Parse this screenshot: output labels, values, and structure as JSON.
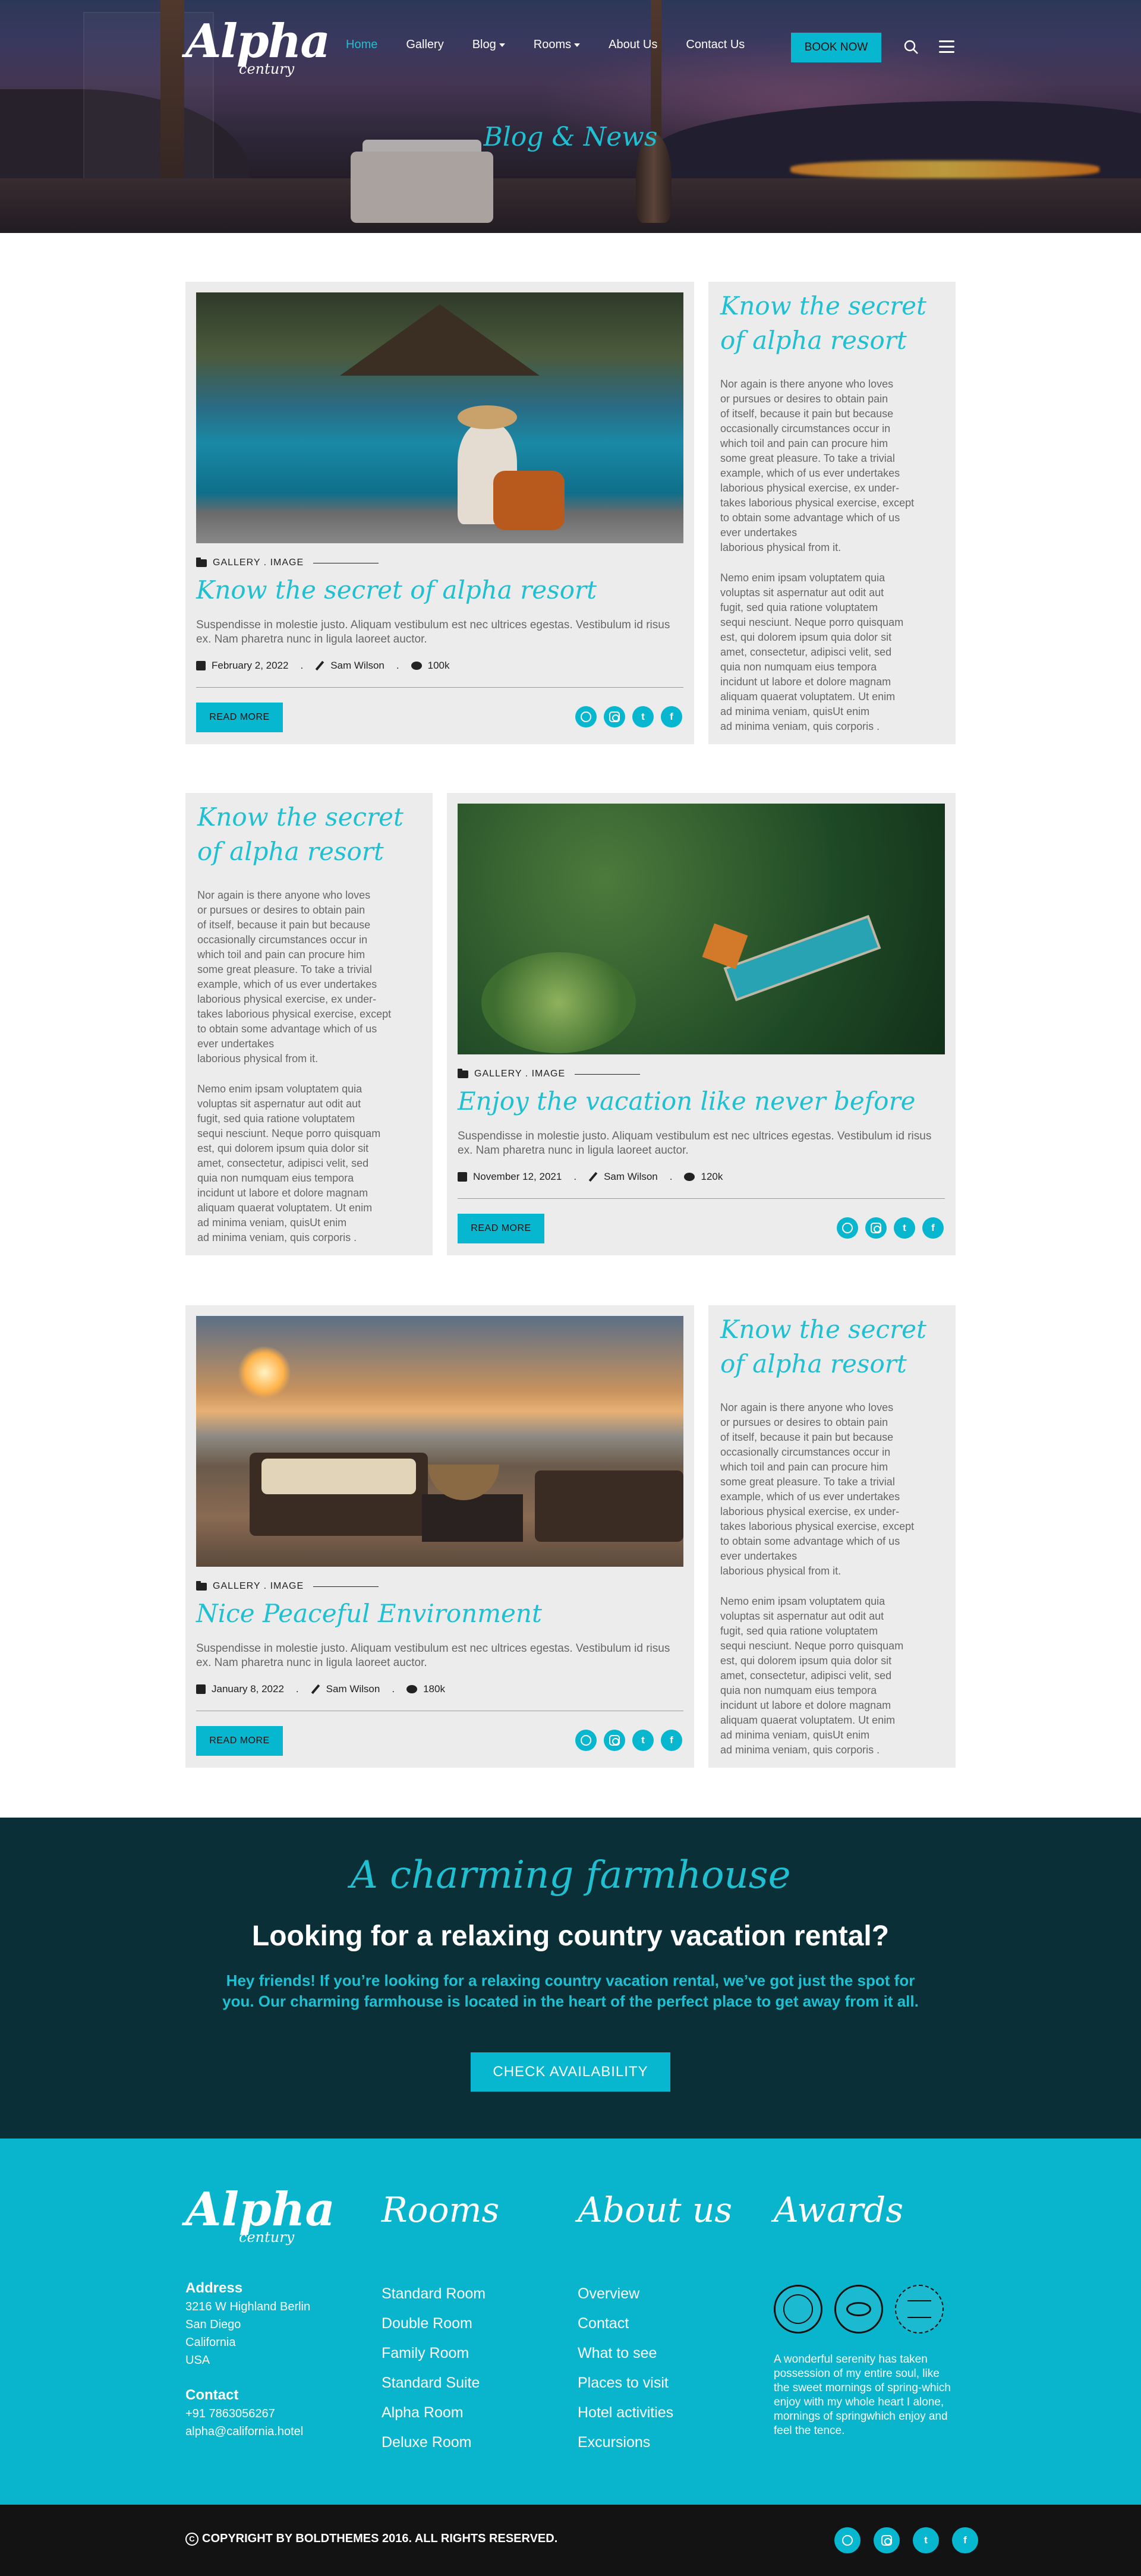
{
  "brand": {
    "name": "Alpha",
    "sub": "century"
  },
  "nav": {
    "items": [
      {
        "label": "Home",
        "active": true
      },
      {
        "label": "Gallery"
      },
      {
        "label": "Blog",
        "dropdown": true
      },
      {
        "label": "Rooms",
        "dropdown": true
      },
      {
        "label": "About Us"
      },
      {
        "label": "Contact Us"
      }
    ],
    "book_label": "BOOK NOW"
  },
  "hero": {
    "title": "Blog & News"
  },
  "posts": [
    {
      "tags": "GALLERY  .  IMAGE",
      "title": "Know the secret of alpha resort",
      "excerpt": "Suspendisse in molestie justo. Aliquam vestibulum est nec ultrices egestas. Vestibulum id risus ex. Nam pharetra nunc in ligula laoreet auctor.",
      "date": "February 2, 2022",
      "author": "Sam Wilson",
      "views": "100k",
      "read_label": "READ MORE"
    },
    {
      "tags": "GALLERY  .  IMAGE",
      "title": "Enjoy the vacation like never before",
      "excerpt": "Suspendisse in molestie justo. Aliquam vestibulum est nec ultrices egestas. Vestibulum id risus ex. Nam pharetra nunc in ligula laoreet auctor.",
      "date": "November 12, 2021",
      "author": "Sam Wilson",
      "views": "120k",
      "read_label": "READ MORE"
    },
    {
      "tags": "GALLERY  .  IMAGE",
      "title": "Nice Peaceful Environment",
      "excerpt": "Suspendisse in molestie justo. Aliquam vestibulum est nec ultrices egestas. Vestibulum id risus ex. Nam pharetra nunc in ligula laoreet auctor.",
      "date": "January 8, 2022",
      "author": "Sam Wilson",
      "views": "180k",
      "read_label": "READ MORE"
    }
  ],
  "sidebar": {
    "title_line1": "Know the secret",
    "title_line2": "of alpha resort",
    "para1": "Nor again is there anyone who loves\nor pursues or desires to obtain pain\nof itself, because it pain but because\noccasionally circumstances occur in\nwhich toil and pain can procure him\nsome great pleasure. To take a trivial\nexample, which of us ever undertakes\nlaborious physical exercise, ex  under-\ntakes laborious physical exercise, except\nto obtain some advantage which of us\never undertakes\nlaborious physical from it.",
    "para2": "Nemo enim ipsam voluptatem quia\nvoluptas sit aspernatur aut odit aut\nfugit, sed quia ratione voluptatem\nsequi nesciunt. Neque porro quisquam\nest, qui dolorem ipsum quia dolor sit\namet, consectetur, adipisci velit, sed\nquia non numquam eius tempora\nincidunt ut labore et dolore magnam\naliquam quaerat voluptatem. Ut enim\nad minima veniam, quisUt enim\nad minima veniam, quis corporis ."
  },
  "cta": {
    "script": "A charming farmhouse",
    "title": "Looking for a relaxing country vacation rental?",
    "text": "Hey friends! If you’re looking for a relaxing country vacation rental, we’ve got just the spot for you. Our charming farmhouse is located in the heart of the perfect place to get away from it all.",
    "button": "CHECK AVAILABILITY"
  },
  "footer": {
    "address_label": "Address",
    "address": "3216 W Highland Berlin\nSan Diego\nCalifornia\nUSA",
    "contact_label": "Contact",
    "contact": "+91 7863056267\nalpha@california.hotel",
    "rooms_title": "Rooms",
    "rooms": [
      "Standard Room",
      "Double Room",
      "Family Room",
      "Standard Suite",
      "Alpha Room",
      "Deluxe Room"
    ],
    "about_title": "About us",
    "about": [
      "Overview",
      "Contact",
      "What to see",
      "Places to visit",
      "Hotel activities",
      "Excursions"
    ],
    "awards_title": "Awards",
    "award_text": "A wonderful serenity has taken possession of my entire soul, like the sweet mornings of spring-which enjoy with my whole heart I alone, mornings of springwhich enjoy and feel the tence."
  },
  "copyright": "COPYRIGHT BY BOLDTHEMES 2016. ALL RIGHTS RESERVED.",
  "colors": {
    "accent": "#06b7cf",
    "dark": "#0b2f37",
    "card": "#ececec"
  }
}
